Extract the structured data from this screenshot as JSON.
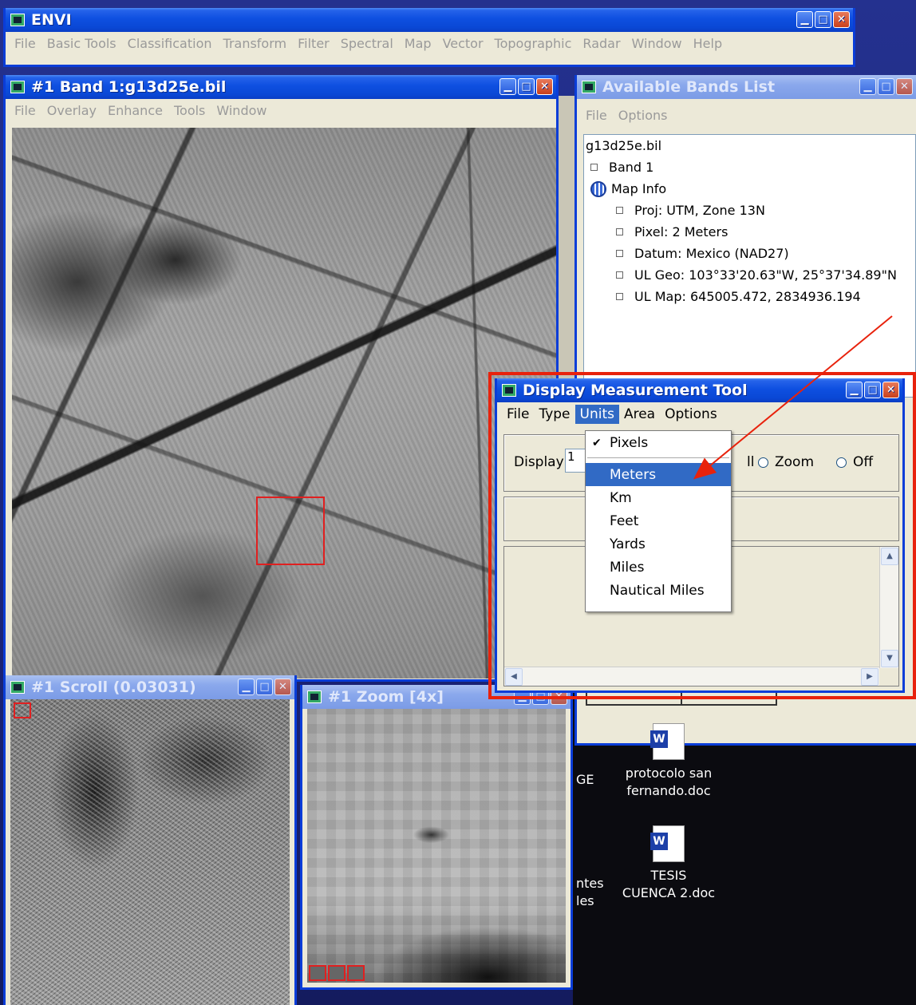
{
  "envi": {
    "title": "ENVI",
    "menu": [
      "File",
      "Basic Tools",
      "Classification",
      "Transform",
      "Filter",
      "Spectral",
      "Map",
      "Vector",
      "Topographic",
      "Radar",
      "Window",
      "Help"
    ]
  },
  "band_window": {
    "title": "#1 Band 1:g13d25e.bil",
    "menu": [
      "File",
      "Overlay",
      "Enhance",
      "Tools",
      "Window"
    ]
  },
  "bands_list": {
    "title": "Available Bands List",
    "menu": [
      "File",
      "Options"
    ],
    "file": "g13d25e.bil",
    "band": "Band 1",
    "map_info": "Map Info",
    "info_items": [
      "Proj: UTM, Zone 13N",
      "Pixel: 2 Meters",
      "Datum: Mexico (NAD27)",
      "UL Geo: 103°33'20.63\"W, 25°37'34.89\"N",
      "UL Map: 645005.472, 2834936.194"
    ]
  },
  "measure_tool": {
    "title": "Display Measurement Tool",
    "menu": [
      "File",
      "Type",
      "Units",
      "Area",
      "Options"
    ],
    "active_menu": "Units",
    "display_label": "Display",
    "display_value": "1",
    "partial_radio": "ll",
    "radio_zoom": "Zoom",
    "radio_off": "Off"
  },
  "units_menu": {
    "checked": "Pixels",
    "items": [
      "Meters",
      "Km",
      "Feet",
      "Yards",
      "Miles",
      "Nautical Miles"
    ],
    "selected": "Meters"
  },
  "scroll_window": {
    "title": "#1 Scroll (0.03031)"
  },
  "zoom_window": {
    "title": "#1 Zoom [4x]"
  },
  "desktop": {
    "icon1_line1": "protocolo san",
    "icon1_line2": "fernando.doc",
    "icon2_line1": "TESIS",
    "icon2_line2": "CUENCA 2.doc",
    "partial_ge": "GE",
    "partial_ntes": "ntes",
    "partial_les": "les"
  },
  "colors": {
    "highlight_red": "#e8220c",
    "xp_blue": "#0a48d6",
    "menu_select": "#316ac5"
  }
}
